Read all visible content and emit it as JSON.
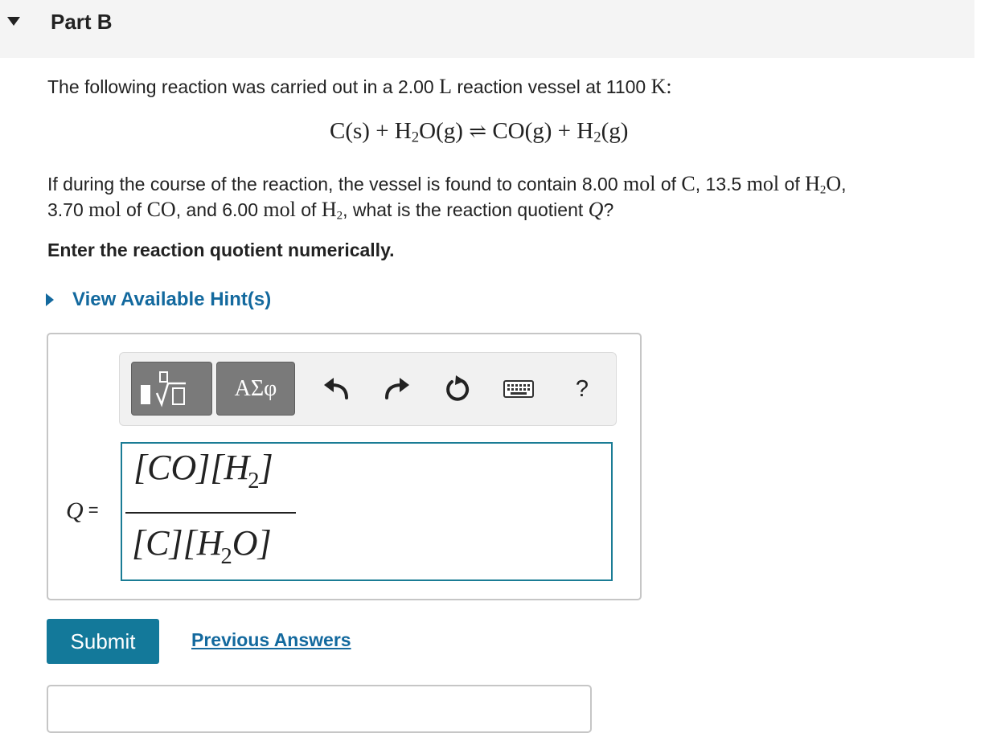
{
  "part": {
    "title": "Part B"
  },
  "question": {
    "line1": {
      "t1": "The following reaction was carried out in a 2.00 ",
      "unit_L": "L",
      "t2": " reaction vessel at 1100 ",
      "unit_K": "K",
      "t3": ":"
    },
    "equation": {
      "reactant1": "C(s) + H",
      "sub1": "2",
      "reactant2": "O(g) ",
      "arrow": "⇌",
      "product1": " CO(g) + H",
      "sub2": "2",
      "product2": "(g)"
    },
    "line2": {
      "t1": "If during the course of the reaction, the vessel is found to contain 8.00 ",
      "m1": "mol",
      "t2": " of ",
      "c": "C",
      "t3": ", 13.5 ",
      "m2": "mol",
      "t4": " of ",
      "h2o_a": "H",
      "h2o_sub": "2",
      "h2o_b": "O",
      "t5": ","
    },
    "line3": {
      "t1": "3.70 ",
      "m1": "mol",
      "t2": " of ",
      "co": "CO",
      "t3": ", and 6.00 ",
      "m2": "mol",
      "t4": " of ",
      "h2_a": "H",
      "h2_sub": "2",
      "t5": ", what is the reaction quotient ",
      "q": "Q",
      "t6": "?"
    },
    "instruction": "Enter the reaction quotient numerically."
  },
  "hints": {
    "label": "View Available Hint(s)"
  },
  "toolbar": {
    "symbols_label": "ΑΣφ",
    "help_label": "?",
    "icons": [
      "templates-icon",
      "undo-icon",
      "redo-icon",
      "reset-icon",
      "keyboard-icon"
    ]
  },
  "answer": {
    "q_symbol": "Q",
    "equals": " =",
    "numerator": {
      "a": "[CO][H",
      "sub": "2",
      "b": "]"
    },
    "denominator": {
      "a": "[C][H",
      "sub": "2",
      "b": "O]"
    }
  },
  "actions": {
    "submit_label": "Submit",
    "previous_answers_label": "Previous Answers"
  },
  "colors": {
    "link": "#13699e",
    "submit_bg": "#13799a",
    "field_border": "#1a7c95",
    "header_bg": "#f4f4f4",
    "tool_button_bg": "#7a7a7a"
  }
}
